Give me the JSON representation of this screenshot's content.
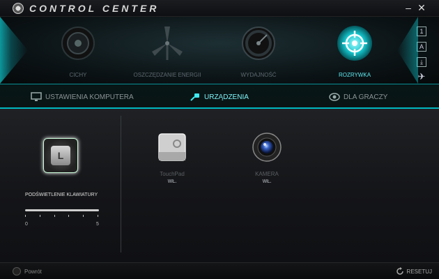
{
  "window": {
    "title": "CONTROL CENTER",
    "minimize_label": "–",
    "close_label": "✕"
  },
  "modes": [
    {
      "id": "quiet",
      "label": "CICHY",
      "icon": "speaker-icon",
      "active": false
    },
    {
      "id": "power-saving",
      "label": "OSZCZĘDZANIE ENERGII",
      "icon": "windmill-icon",
      "active": false
    },
    {
      "id": "performance",
      "label": "WYDAJNOŚĆ",
      "icon": "gauge-icon",
      "active": false
    },
    {
      "id": "entertainment",
      "label": "ROZRYWKA",
      "icon": "crosshair-icon",
      "active": true
    }
  ],
  "side_icons": [
    {
      "name": "number-one-icon",
      "glyph": "1"
    },
    {
      "name": "letter-a-icon",
      "glyph": "A"
    },
    {
      "name": "download-icon",
      "glyph": "⤓"
    },
    {
      "name": "airplane-icon",
      "glyph": "✈"
    }
  ],
  "tabs": [
    {
      "label": "USTAWIENIA KOMPUTERA",
      "icon": "monitor-icon",
      "active": false
    },
    {
      "label": "URZĄDZENIA",
      "icon": "plug-icon",
      "active": true
    },
    {
      "label": "DLA GRACZY",
      "icon": "eye-icon",
      "active": false
    }
  ],
  "keyboard_backlight": {
    "key_glyph": "L",
    "label": "PODŚWIETLENIE KLAWIATURY",
    "min": "0",
    "max": "5",
    "level": 0
  },
  "devices": [
    {
      "name": "TouchPad",
      "status": "WŁ.",
      "icon": "touchpad-icon"
    },
    {
      "name": "KAMERA",
      "status": "WŁ.",
      "icon": "camera-icon"
    }
  ],
  "bottom": {
    "back_label": "Powrót",
    "reset_label": "RESETUJ"
  },
  "colors": {
    "accent": "#00c8d2",
    "active_text": "#5fe9f0",
    "inactive_text": "#5d6a70"
  }
}
